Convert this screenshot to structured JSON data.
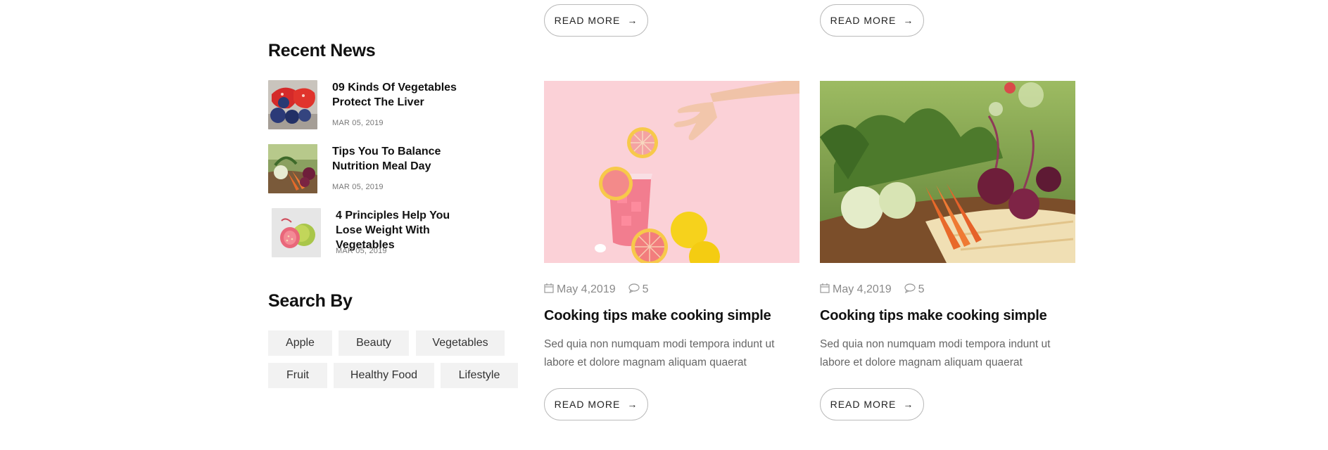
{
  "sidebar": {
    "recent_news_title": "Recent News",
    "news": [
      {
        "title": "09 Kinds Of Vegetables Protect The Liver",
        "date": "MAR 05, 2019",
        "thumb_icon": "strawberry-blueberry-photo"
      },
      {
        "title": "Tips You To Balance Nutrition Meal Day",
        "date": "MAR 05, 2019",
        "thumb_icon": "vegetable-basket-photo"
      },
      {
        "title": "4 Principles Help You Lose Weight With Vegetables",
        "date": "MAR 05, 2019",
        "thumb_icon": "guava-photo"
      }
    ],
    "search_by_title": "Search By",
    "tags": [
      "Apple",
      "Beauty",
      "Vegetables",
      "Fruit",
      "Healthy Food",
      "Lifestyle"
    ]
  },
  "top_buttons": {
    "left_label": "READ MORE",
    "right_label": "READ MORE"
  },
  "posts": [
    {
      "image_icon": "grapefruit-drink-photo",
      "date": "May 4,2019",
      "comments": "5",
      "title": "Cooking tips make cooking simple",
      "excerpt": "Sed quia non numquam modi tempora indunt ut labore et dolore magnam aliquam quaerat",
      "button_label": "READ MORE"
    },
    {
      "image_icon": "vegetable-basket-photo",
      "date": "May 4,2019",
      "comments": "5",
      "title": "Cooking tips make cooking simple",
      "excerpt": "Sed quia non numquam modi tempora indunt ut labore et dolore magnam aliquam quaerat",
      "button_label": "READ MORE"
    }
  ],
  "colors": {
    "tag_bg": "#f2f2f2",
    "meta_gray": "#8a8a8a",
    "text_gray": "#666666",
    "heading": "#111111"
  }
}
